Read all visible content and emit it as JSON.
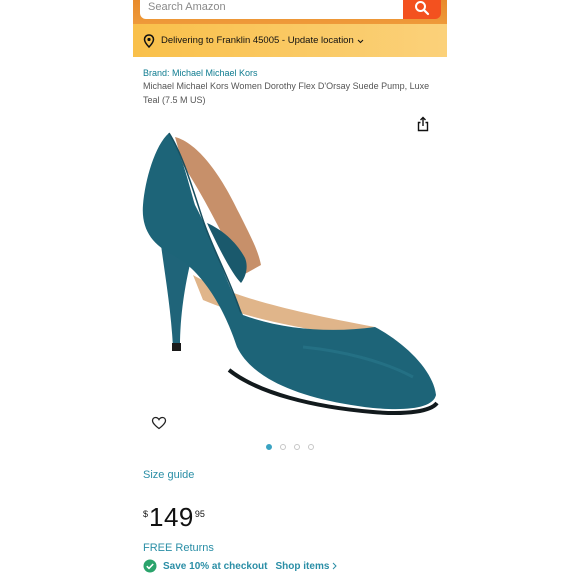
{
  "search": {
    "placeholder": "Search Amazon"
  },
  "delivery": {
    "text": "Delivering to Franklin 45005 - Update location"
  },
  "product": {
    "brand": "Brand: Michael Michael Kors",
    "title": "Michael Michael Kors Women Dorothy Flex D'Orsay Suede Pump, Luxe Teal (7.5 M US)",
    "image_alt": "teal suede d'orsay pump shoe",
    "carousel": {
      "count": 4,
      "active_index": 0
    }
  },
  "size_guide": "Size guide",
  "price": {
    "currency": "$",
    "whole": "149",
    "fraction": "95"
  },
  "free_returns": "FREE Returns",
  "promo": {
    "save_text": "Save 10% at checkout",
    "shop_text": "Shop items"
  },
  "icons": [
    "search-icon",
    "location-pin-icon",
    "chevron-down-icon",
    "share-icon",
    "heart-icon",
    "check-circle-icon",
    "chevron-right-icon"
  ],
  "colors": {
    "accent_link": "#2a8ea6",
    "search_button": "#f3511f",
    "delivery_bar": "#f9c04a",
    "shoe": "#1d6478",
    "promo_check": "#2aa36b"
  }
}
